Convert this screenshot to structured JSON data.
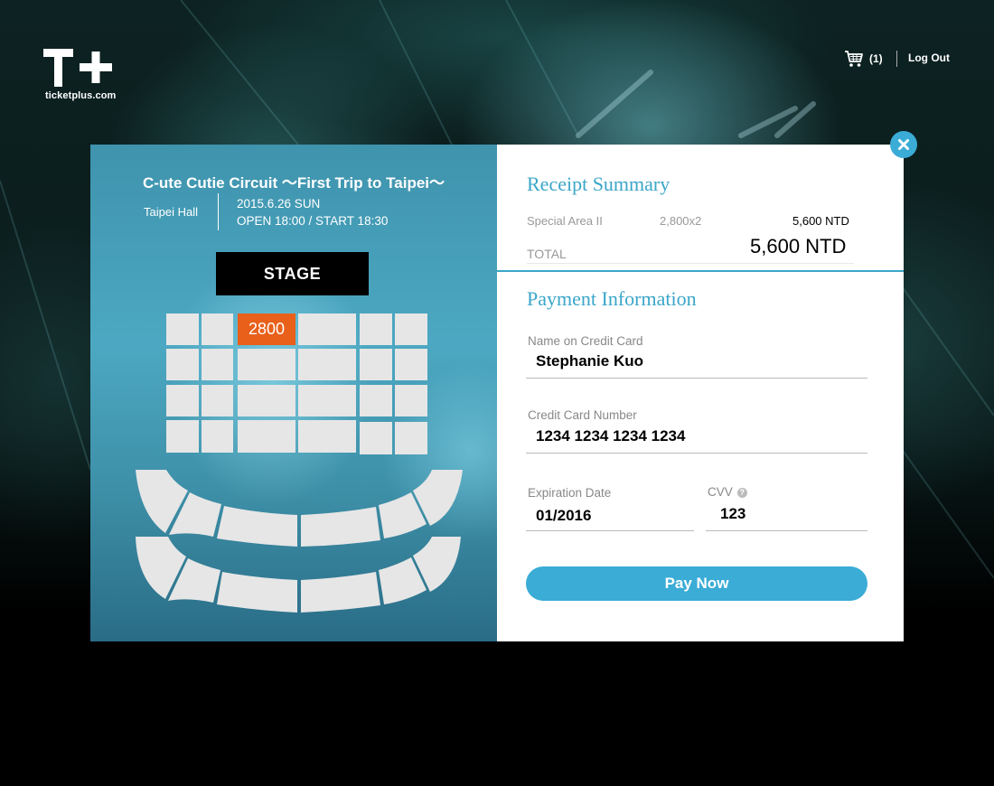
{
  "header": {
    "logo_domain": "ticketplus.com",
    "cart_count": "(1)",
    "logout_label": "Log Out",
    "icons": {
      "cart": "shopping-cart-icon",
      "close": "close-icon",
      "help": "question-icon"
    }
  },
  "event": {
    "title": "C-ute Cutie Circuit ～First Trip to Taipei～",
    "venue": "Taipei Hall",
    "date": "2015.6.26 SUN",
    "time": "OPEN 18:00 / START 18:30"
  },
  "seatmap": {
    "stage_label": "STAGE",
    "selected_price": "2800"
  },
  "receipt": {
    "title": "Receipt Summary",
    "item_name": "Special Area II",
    "item_qty": "2,800x2",
    "item_subtotal": "5,600 NTD",
    "total_label": "TOTAL",
    "total_value": "5,600 NTD"
  },
  "payment": {
    "title": "Payment Information",
    "name_label": "Name on Credit Card",
    "name_value": "Stephanie Kuo",
    "card_label": "Credit Card Number",
    "card_value": "1234 1234 1234 1234",
    "exp_label": "Expiration Date",
    "exp_value": "01/2016",
    "cvv_label": "CVV",
    "cvv_value": "123",
    "pay_label": "Pay Now"
  },
  "colors": {
    "accent": "#3aacd6",
    "selected_seat": "#e8601a",
    "seat": "#e6e6e6"
  }
}
